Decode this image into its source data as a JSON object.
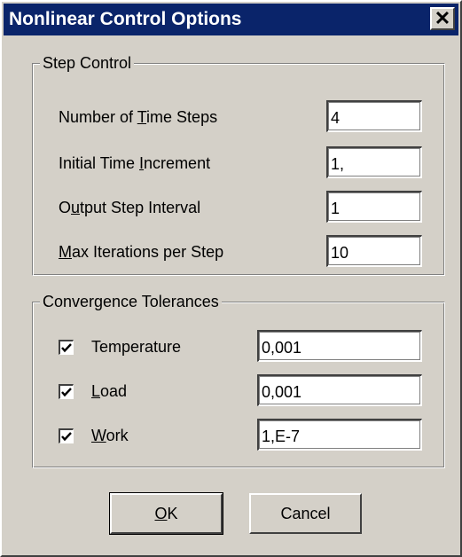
{
  "window": {
    "title": "Nonlinear Control Options",
    "close_glyph": "✕"
  },
  "step_control": {
    "title": "Step Control",
    "rows": [
      {
        "pre": "Number of ",
        "key": "T",
        "post": "ime Steps",
        "value": "4"
      },
      {
        "pre": "Initial Time ",
        "key": "I",
        "post": "ncrement",
        "value": "1,"
      },
      {
        "pre": "O",
        "key": "u",
        "post": "tput Step Interval",
        "value": "1"
      },
      {
        "pre": "",
        "key": "M",
        "post": "ax Iterations per Step",
        "value": "10"
      }
    ]
  },
  "convergence": {
    "title": "Convergence Tolerances",
    "rows": [
      {
        "pre": "Temperature",
        "key": "",
        "post": "",
        "value": "0,001",
        "checked": true
      },
      {
        "pre": "",
        "key": "L",
        "post": "oad",
        "value": "0,001",
        "checked": true
      },
      {
        "pre": "",
        "key": "W",
        "post": "ork",
        "value": "1,E-7",
        "checked": true
      }
    ]
  },
  "buttons": {
    "ok": {
      "key": "O",
      "post": "K"
    },
    "cancel": "Cancel"
  }
}
